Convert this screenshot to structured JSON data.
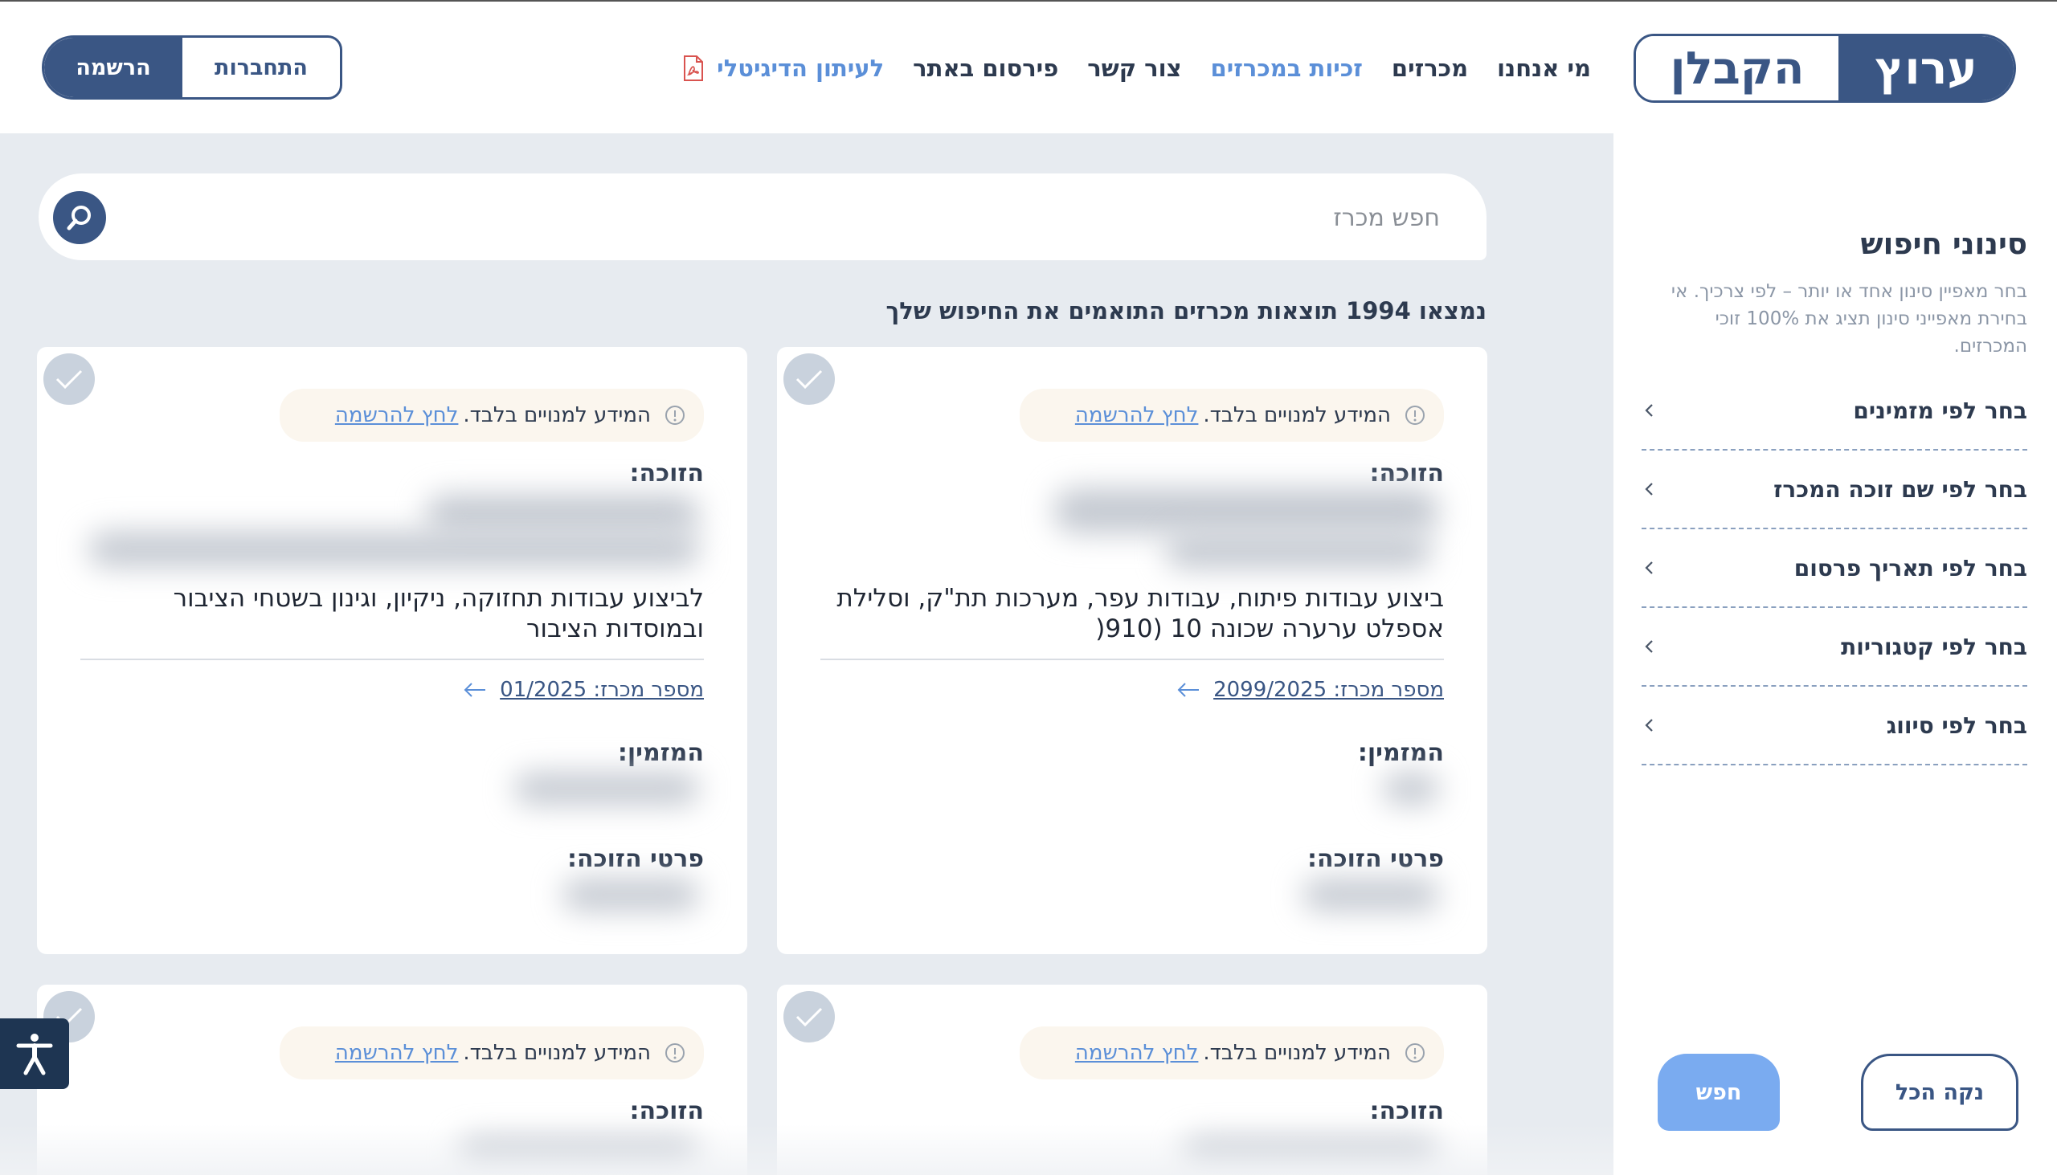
{
  "header": {
    "logo_main": "ערוץ",
    "logo_sub": "הקבלן",
    "nav": [
      {
        "label": "מי אנחנו",
        "active": false
      },
      {
        "label": "מכרזים",
        "active": false
      },
      {
        "label": "זכיות במכרזים",
        "active": true
      },
      {
        "label": "צור קשר",
        "active": false
      },
      {
        "label": "פירסום באתר",
        "active": false
      },
      {
        "label": "לעיתון הדיגיטלי",
        "active": true
      }
    ],
    "login_label": "התחברות",
    "register_label": "הרשמה"
  },
  "search": {
    "placeholder": "חפש מכרז"
  },
  "results": {
    "count_text": "נמצאו 1994 תוצאות מכרזים התואמים את החיפוש שלך"
  },
  "cards": [
    {
      "notice_text": "המידע למנויים בלבד.",
      "notice_link": "לחץ להרשמה",
      "winner_label": "הזוכה:",
      "description": "ביצוע עבודות פיתוח, עבודות עפר, מערכות תת\"ק, וסלילת אספלט ערערה שכונה 10 (910(",
      "tender_link": "מספר מכרז: 2099/2025",
      "issuer_label": "המזמין:",
      "details_label": "פרטי הזוכה:"
    },
    {
      "notice_text": "המידע למנויים בלבד.",
      "notice_link": "לחץ להרשמה",
      "winner_label": "הזוכה:",
      "description": "לביצוע עבודות תחזוקה, ניקיון, וגינון בשטחי הציבור ובמוסדות הציבור",
      "tender_link": "מספר מכרז: 01/2025",
      "issuer_label": "המזמין:",
      "details_label": "פרטי הזוכה:"
    },
    {
      "notice_text": "המידע למנויים בלבד.",
      "notice_link": "לחץ להרשמה",
      "winner_label": "הזוכה:"
    },
    {
      "notice_text": "המידע למנויים בלבד.",
      "notice_link": "לחץ להרשמה",
      "winner_label": "הזוכה:"
    }
  ],
  "sidebar": {
    "title": "סינוני חיפוש",
    "description": "בחר מאפיין סינון אחד או יותר – לפי צרכיך. אי בחירת מאפייני סינון תציג את 100% זוכי המכרזים.",
    "filters": [
      {
        "label": "בחר לפי מזמינים"
      },
      {
        "label": "בחר לפי שם זוכה המכרז"
      },
      {
        "label": "בחר לפי תאריך פרסום"
      },
      {
        "label": "בחר לפי קטגוריות"
      },
      {
        "label": "בחר לפי סיווג"
      }
    ],
    "clear_label": "נקה הכל",
    "search_label": "חפש"
  },
  "colors": {
    "brand": "#3a5684",
    "accent": "#5b8fd8",
    "background": "#e7ebf0"
  }
}
